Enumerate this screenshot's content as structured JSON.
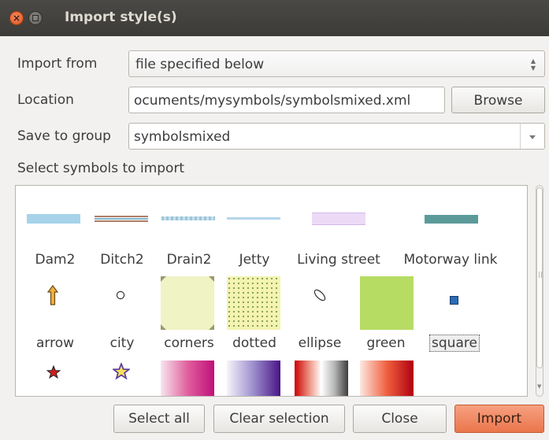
{
  "window": {
    "title": "Import style(s)"
  },
  "form": {
    "import_from_label": "Import from",
    "import_from_value": "file specified below",
    "location_label": "Location",
    "location_value": "ocuments/mysymbols/symbolsmixed.xml",
    "browse_label": "Browse",
    "save_group_label": "Save to group",
    "save_group_value": "symbolsmixed",
    "select_symbols_label": "Select symbols to import"
  },
  "symbols": [
    {
      "name": "Dam2",
      "kind": "line",
      "color": "#a6d3ea"
    },
    {
      "name": "Ditch2",
      "kind": "line",
      "color": "#b07c66"
    },
    {
      "name": "Drain2",
      "kind": "line",
      "color": "#9cc5d8"
    },
    {
      "name": "Jetty",
      "kind": "line",
      "color": "#b4d6ea"
    },
    {
      "name": "Living street",
      "kind": "line",
      "color": "#ecdaf6"
    },
    {
      "name": "Motorway link",
      "kind": "line",
      "color": "#5c9a9a"
    },
    {
      "name": "arrow",
      "kind": "marker",
      "icon": "arrow-up-icon",
      "color": "#f0b040"
    },
    {
      "name": "city",
      "kind": "marker",
      "icon": "circle-icon",
      "color": "#ffffff"
    },
    {
      "name": "corners",
      "kind": "fill",
      "color": "#f0f3c4"
    },
    {
      "name": "dotted",
      "kind": "fill",
      "color": "#f4f3b0"
    },
    {
      "name": "ellipse",
      "kind": "marker",
      "icon": "ellipse-icon",
      "color": "#ffffff"
    },
    {
      "name": "green",
      "kind": "fill",
      "color": "#b6dc64"
    },
    {
      "name": "square",
      "kind": "marker",
      "icon": "square-icon",
      "color": "#2a6cb8"
    },
    {
      "name": "",
      "kind": "marker",
      "icon": "star-icon",
      "color": "#d01e1e"
    },
    {
      "name": "",
      "kind": "marker",
      "icon": "star-icon",
      "color": "#f8e25a"
    },
    {
      "name": "",
      "kind": "gradient",
      "icon": "gradient-pink",
      "color": "#c0107a"
    },
    {
      "name": "",
      "kind": "gradient",
      "icon": "gradient-purple",
      "color": "#4a1486"
    },
    {
      "name": "",
      "kind": "gradient",
      "icon": "gradient-red-grey",
      "color": "#cc0000"
    },
    {
      "name": "",
      "kind": "gradient",
      "icon": "gradient-red",
      "color": "#b00010"
    }
  ],
  "buttons": {
    "select_all": "Select all",
    "clear_selection": "Clear selection",
    "close": "Close",
    "import": "Import"
  }
}
